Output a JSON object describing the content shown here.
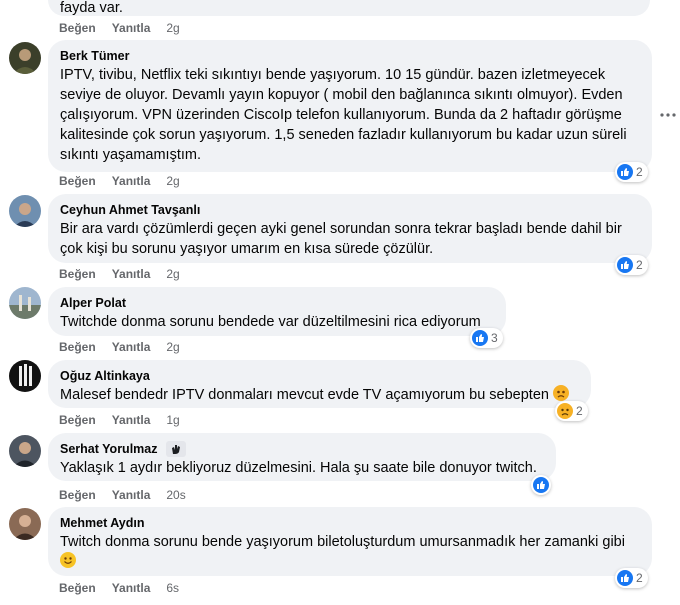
{
  "top": {
    "text_tail": "fayda var.",
    "actions": {
      "like": "Beğen",
      "reply": "Yanıtla",
      "time": "2g"
    }
  },
  "comments": [
    {
      "name": "Berk Tümer",
      "text": "IPTV, tivibu, Netflix teki sıkıntıyı bende yaşıyorum. 10 15 gündür. bazen izletmeyecek seviye de oluyor. Devamlı yayın kopuyor ( mobil den bağlanınca sıkıntı olmuyor). Evden çalışıyorum. VPN üzerinden CiscoIp telefon kullanıyorum. Bunda da 2 haftadır görüşme kalitesinde çok sorun yaşıyorum. 1,5 seneden fazladır kullanıyorum bu kadar uzun süreli sıkıntı yaşamamıştım.",
      "actions": {
        "like": "Beğen",
        "reply": "Yanıtla",
        "time": "2g"
      },
      "reaction_count": "2"
    },
    {
      "name": "Ceyhun Ahmet Tavşanlı",
      "text": "Bir ara vardı çözümlerdi geçen ayki genel sorundan sonra tekrar başladı bende dahil bir çok kişi bu sorunu yaşıyor umarım en kısa sürede çözülür.",
      "actions": {
        "like": "Beğen",
        "reply": "Yanıtla",
        "time": "2g"
      },
      "reaction_count": "2"
    },
    {
      "name": "Alper Polat",
      "text": "Twitchde donma sorunu bendede var düzeltilmesini rica ediyorum",
      "actions": {
        "like": "Beğen",
        "reply": "Yanıtla",
        "time": "2g"
      },
      "reaction_count": "3"
    },
    {
      "name": "Oğuz Altinkaya",
      "text": "Malesef bendedr IPTV donmaları mevcut evde TV açamıyorum bu sebepten",
      "actions": {
        "like": "Beğen",
        "reply": "Yanıtla",
        "time": "1g"
      },
      "reaction_count": "2"
    },
    {
      "name": "Serhat Yorulmaz",
      "text": "Yaklaşık 1 aydır bekliyoruz düzelmesini. Hala şu saate bile donuyor twitch.",
      "actions": {
        "like": "Beğen",
        "reply": "Yanıtla",
        "time": "20s"
      },
      "reaction_count": ""
    },
    {
      "name": "Mehmet Aydın",
      "text": "Twitch donma sorunu bende yaşıyorum biletoluşturdum umursanmadık her zamanki gibi",
      "actions": {
        "like": "Beğen",
        "reply": "Yanıtla",
        "time": "6s"
      },
      "reaction_count": "2"
    }
  ],
  "icons": {
    "like": "like-icon",
    "sad": "sad-face-icon",
    "more": "more-options-icon",
    "badge": "wave-hand-badge-icon",
    "smile": "smile-emoji-icon"
  },
  "colors": {
    "bubble": "#f0f2f5",
    "like_blue": "#1877f2",
    "secondary_text": "#65676b"
  }
}
